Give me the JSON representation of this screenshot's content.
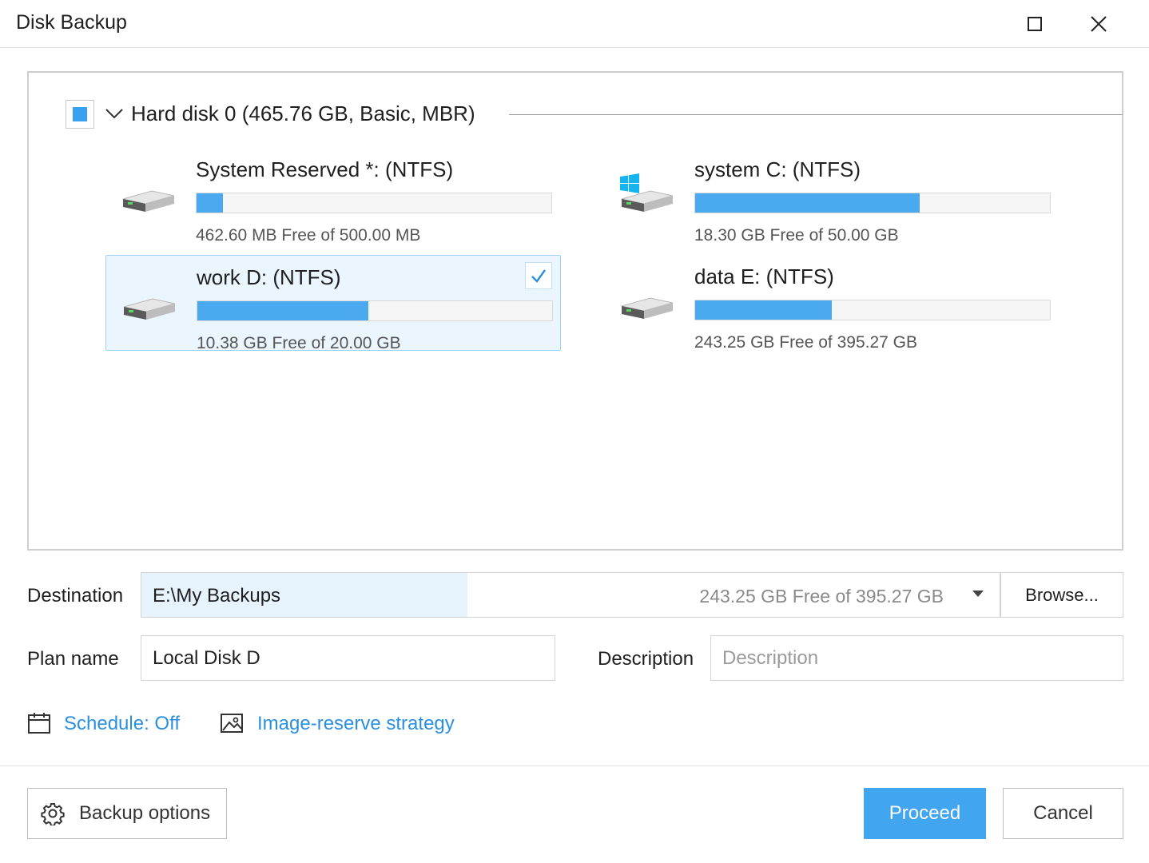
{
  "window": {
    "title": "Disk Backup"
  },
  "disk": {
    "label": "Hard disk 0 (465.76 GB, Basic, MBR)",
    "partitions": [
      {
        "name": "System Reserved *: (NTFS)",
        "free_text": "462.60 MB Free of 500.00 MB",
        "used_fraction": 0.075,
        "selected": false,
        "system": false
      },
      {
        "name": "system C: (NTFS)",
        "free_text": "18.30 GB Free of 50.00 GB",
        "used_fraction": 0.634,
        "selected": false,
        "system": true
      },
      {
        "name": "work D: (NTFS)",
        "free_text": "10.38 GB Free of 20.00 GB",
        "used_fraction": 0.481,
        "selected": true,
        "system": false
      },
      {
        "name": "data E: (NTFS)",
        "free_text": "243.25 GB Free of 395.27 GB",
        "used_fraction": 0.385,
        "selected": false,
        "system": false
      }
    ]
  },
  "destination": {
    "label": "Destination",
    "value": "E:\\My Backups",
    "free_text": "243.25 GB Free of 395.27 GB",
    "browse_label": "Browse..."
  },
  "plan": {
    "label": "Plan name",
    "value": "Local Disk D"
  },
  "description": {
    "label": "Description",
    "placeholder": "Description",
    "value": ""
  },
  "links": {
    "schedule": "Schedule: Off",
    "image_reserve": "Image-reserve strategy"
  },
  "footer": {
    "backup_options": "Backup options",
    "proceed": "Proceed",
    "cancel": "Cancel"
  },
  "colors": {
    "accent": "#42a5f0",
    "bar_fill": "#4ba9f0",
    "link": "#2b8fe0",
    "selected_bg": "#eaf5fd"
  }
}
